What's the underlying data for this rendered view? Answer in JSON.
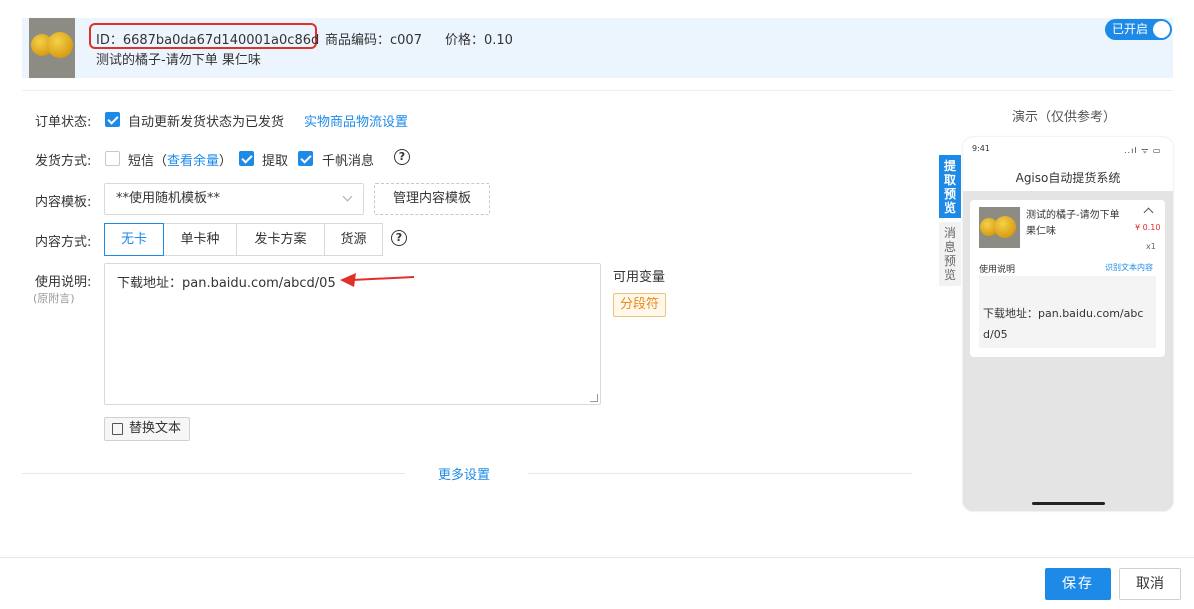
{
  "header": {
    "id_text": "ID：6687ba0da67d140001a0c86d",
    "product_code": "商品编码：c007",
    "price": "价格：0.10",
    "title": "测试的橘子-请勿下单 果仁味",
    "toggle_label": "已开启"
  },
  "form": {
    "order_status": {
      "label": "订单状态:",
      "checkbox_label": "自动更新发货状态为已发货",
      "link": "实物商品物流设置"
    },
    "delivery_method": {
      "label": "发货方式:",
      "sms_label": "短信（",
      "sms_link": "查看余量",
      "sms_close": "）",
      "pickup_label": "提取",
      "qianniu_label": "千帆消息",
      "help": "?"
    },
    "content_template": {
      "label": "内容模板:",
      "selected": "**使用随机模板**",
      "manage_button": "管理内容模板"
    },
    "content_method": {
      "label": "内容方式:",
      "options": [
        "无卡",
        "单卡种",
        "发卡方案",
        "货源"
      ],
      "help": "?"
    },
    "usage": {
      "label": "使用说明:",
      "sub_label": "(原附言)",
      "value": "下载地址：pan.baidu.com/abcd/05",
      "vars_title": "可用变量",
      "var_tag": "分段符",
      "replace_button": "替换文本"
    },
    "more_settings": "更多设置"
  },
  "footer": {
    "save": "保存",
    "cancel": "取消"
  },
  "preview": {
    "title": "演示（仅供参考）",
    "tab_active": "提取预览",
    "tab_inactive": "消息预览",
    "phone": {
      "time": "9:41",
      "status": "..ıl ᯤ ▭",
      "app_title": "Agiso自动提货系统",
      "item_title": "测试的橘子-请勿下单 果仁味",
      "price": "¥ 0.10",
      "qty": "x1",
      "usage_label": "使用说明",
      "usage_link": "识别文本内容",
      "usage_text": "下载地址：pan.baidu.com/abcd/05"
    }
  },
  "colors": {
    "accent": "#1d8ae8",
    "highlight_red": "#e0302a",
    "header_bg": "#ecf5fd"
  }
}
